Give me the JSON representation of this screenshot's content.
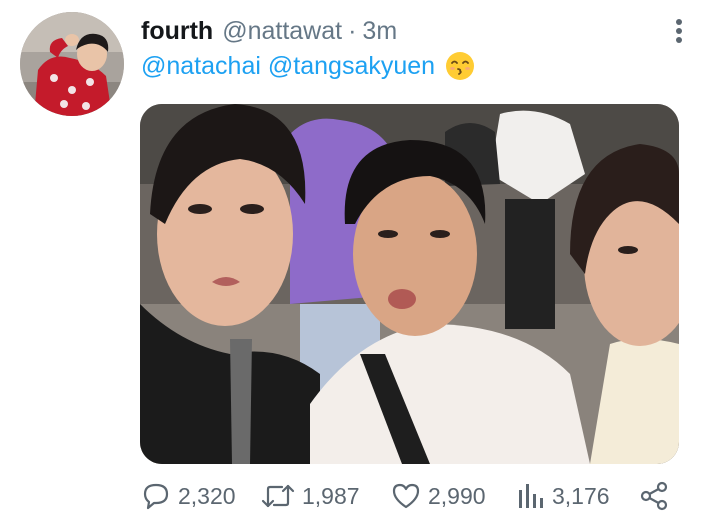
{
  "tweet": {
    "display_name": "fourth",
    "handle": "@nattawat",
    "separator": "·",
    "time": "3m",
    "mentions": [
      "@natachai",
      "@tangsakyuen"
    ],
    "emoji": "kissing-face-with-closed-eyes",
    "media": {
      "description": "Selfie photo of three young men in a crowd on a street"
    },
    "actions": {
      "reply_count": "2,320",
      "retweet_count": "1,987",
      "like_count": "2,990",
      "views_count": "3,176"
    }
  },
  "colors": {
    "link": "#1da1f2",
    "secondary_text": "#657786",
    "primary_text": "#14171a",
    "icon": "#5b6670"
  }
}
